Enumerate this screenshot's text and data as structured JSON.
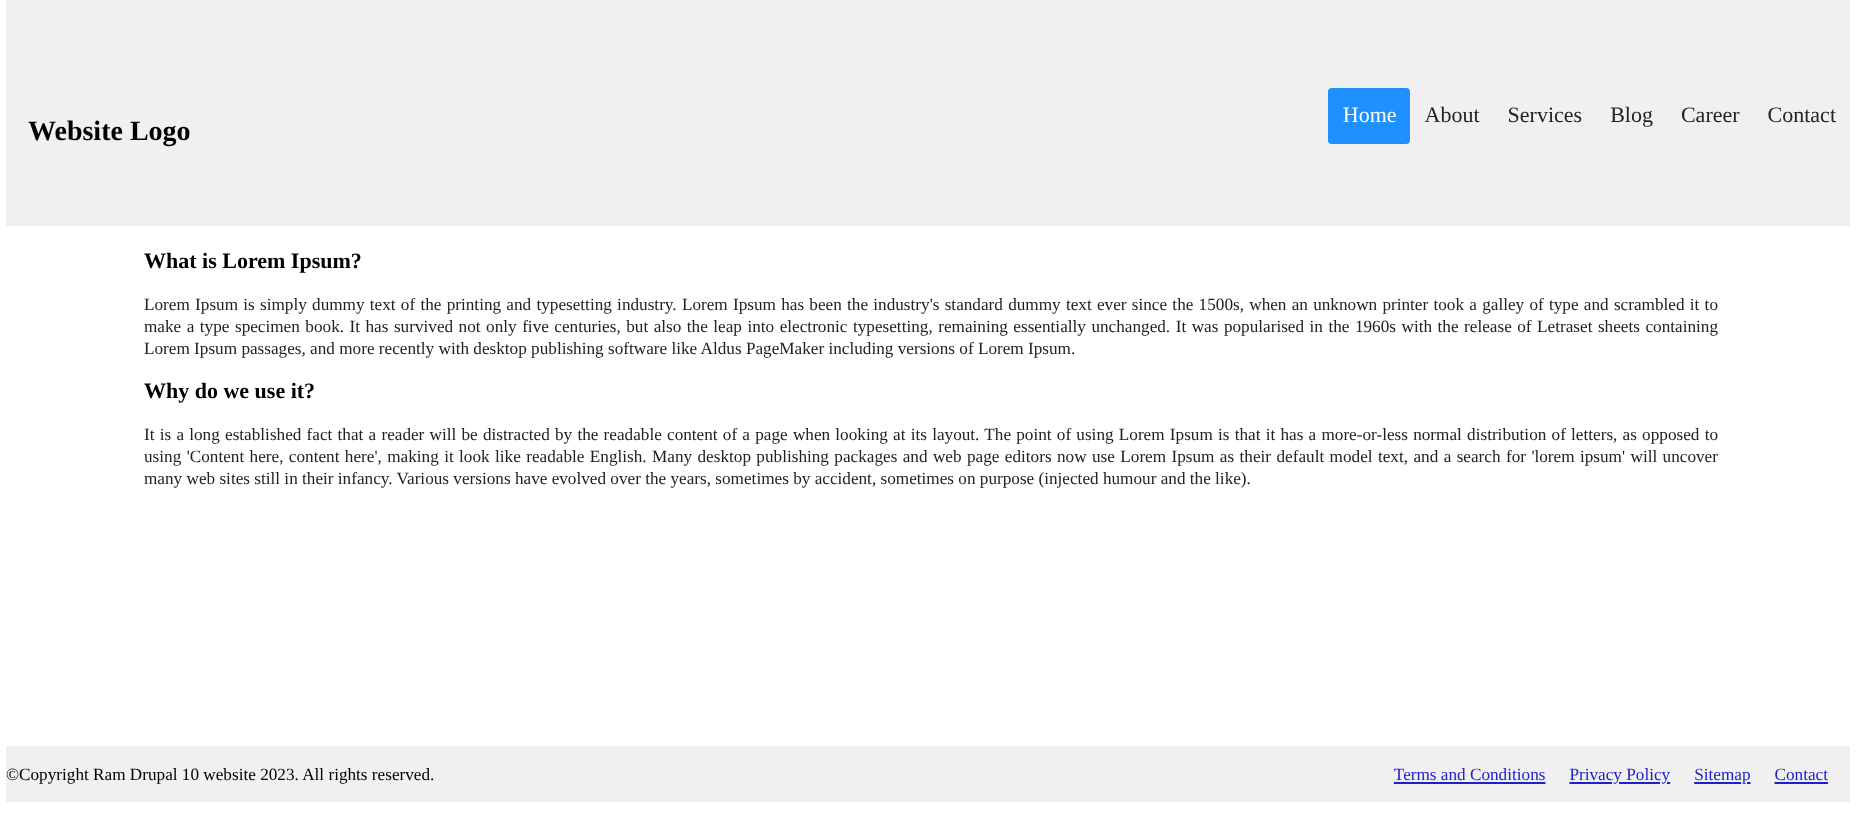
{
  "header": {
    "logo": "Website Logo",
    "nav": [
      {
        "label": "Home",
        "selected": true
      },
      {
        "label": "About",
        "selected": false
      },
      {
        "label": "Services",
        "selected": false
      },
      {
        "label": "Blog",
        "selected": false
      },
      {
        "label": "Career",
        "selected": false
      },
      {
        "label": "Contact",
        "selected": false
      }
    ]
  },
  "sections": [
    {
      "heading": "What is Lorem Ipsum?",
      "text": "Lorem Ipsum is simply dummy text of the printing and typesetting industry. Lorem Ipsum has been the industry's standard dummy text ever since the 1500s, when an unknown printer took a galley of type and scrambled it to make a type specimen book. It has survived not only five centuries, but also the leap into electronic typesetting, remaining essentially unchanged. It was popularised in the 1960s with the release of Letraset sheets containing Lorem Ipsum passages, and more recently with desktop publishing software like Aldus PageMaker including versions of Lorem Ipsum."
    },
    {
      "heading": "Why do we use it?",
      "text": "It is a long established fact that a reader will be distracted by the readable content of a page when looking at its layout. The point of using Lorem Ipsum is that it has a more-or-less normal distribution of letters, as opposed to using 'Content here, content here', making it look like readable English. Many desktop publishing packages and web page editors now use Lorem Ipsum as their default model text, and a search for 'lorem ipsum' will uncover many web sites still in their infancy. Various versions have evolved over the years, sometimes by accident, sometimes on purpose (injected humour and the like)."
    }
  ],
  "footer": {
    "copyright": "©Copyright Ram Drupal 10 website 2023. All rights reserved.",
    "links": [
      "Terms and Conditions",
      "Privacy Policy",
      "Sitemap",
      "Contact"
    ]
  }
}
